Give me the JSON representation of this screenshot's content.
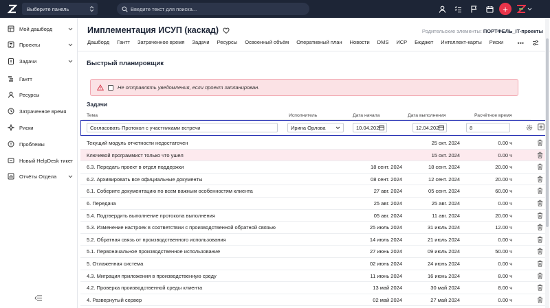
{
  "topbar": {
    "panel_select": "Выберите панель",
    "search_placeholder": "Введите текст для поиска...",
    "plus_label": "+"
  },
  "sidebar": {
    "items": [
      {
        "label": "Мой дашборд",
        "icon": "dashboard-icon",
        "expandable": true
      },
      {
        "label": "Проекты",
        "icon": "projects-icon",
        "expandable": true
      },
      {
        "label": "Задачи",
        "icon": "tasks-icon",
        "expandable": true
      },
      {
        "label": "Гантт",
        "icon": "gantt-icon",
        "expandable": false
      },
      {
        "label": "Ресурсы",
        "icon": "user-icon",
        "expandable": false
      },
      {
        "label": "Затраченное время",
        "icon": "clock-icon",
        "expandable": false
      },
      {
        "label": "Риски",
        "icon": "risk-icon",
        "expandable": false
      },
      {
        "label": "Проблемы",
        "icon": "issue-icon",
        "expandable": false
      },
      {
        "label": "Новый HelpDesk тикет",
        "icon": "ticket-icon",
        "expandable": false
      },
      {
        "label": "Отчёты Отдела",
        "icon": "reports-icon",
        "expandable": true
      }
    ]
  },
  "page": {
    "title": "Имплементация ИСУП (каскад)",
    "parents_label": "Родительские элементы:",
    "parents_value": "ПОРТФЕЛЬ_IT-проекты",
    "more_label": "•••"
  },
  "tabs": [
    "Дашборд",
    "Гантт",
    "Затраченное время",
    "Задачи",
    "Ресурсы",
    "Освоенный объём",
    "Оперативный план",
    "Новости",
    "DMS",
    "ИСР",
    "Бюджет",
    "Интеллект-карты",
    "Риски"
  ],
  "planner": {
    "title": "Быстрый планировщик",
    "alert_text": "Не отправлять уведомления, если проект запланирован.",
    "tasks_title": "Задачи"
  },
  "columns": {
    "subject": "Тема",
    "assignee": "Исполнитель",
    "start": "Дата начала",
    "due": "Дата выполнения",
    "estimate": "Расчётное время"
  },
  "edit_row": {
    "subject": "Согласовать Протокол с участниками встречи",
    "assignee": "Ирина Орлова",
    "start": "10.04.202",
    "due": "12.04.202",
    "estimate": "8"
  },
  "rows": [
    {
      "subject": "Текущий модуль отчетности недостаточен",
      "start": "",
      "due": "25 окт. 2024",
      "estimate": "0.00 ч",
      "highlight": false
    },
    {
      "subject": "Ключевой программист только что ушел",
      "start": "",
      "due": "15 окт. 2024",
      "estimate": "0.00 ч",
      "highlight": true
    },
    {
      "subject": "6.3. Передать проект в отдел поддержки",
      "start": "18 сент. 2024",
      "due": "18 сент. 2024",
      "estimate": "20.00 ч",
      "highlight": false
    },
    {
      "subject": "6.2. Архивировать все официальные документы",
      "start": "08 сент. 2024",
      "due": "12 сент. 2024",
      "estimate": "20.00 ч",
      "highlight": false
    },
    {
      "subject": "6.1. Соберите документацию по всем важным особенностям клиента",
      "start": "27 авг. 2024",
      "due": "05 сент. 2024",
      "estimate": "60.00 ч",
      "highlight": false
    },
    {
      "subject": "6. Передача",
      "start": "25 авг. 2024",
      "due": "25 авг. 2024",
      "estimate": "0.00 ч",
      "highlight": false
    },
    {
      "subject": "5.4. Подтвердить выполнение протокола выполнения",
      "start": "05 авг. 2024",
      "due": "11 авг. 2024",
      "estimate": "20.00 ч",
      "highlight": false
    },
    {
      "subject": "5.3. Изменение настроек в соответствии с производственной обратной связью",
      "start": "25 июль 2024",
      "due": "31 июль 2024",
      "estimate": "12.00 ч",
      "highlight": false
    },
    {
      "subject": "5.2. Обратная связь от производственного использования",
      "start": "14 июль 2024",
      "due": "21 июль 2024",
      "estimate": "0.00 ч",
      "highlight": false
    },
    {
      "subject": "5.1. Первоначальное производственное использование",
      "start": "27 июнь 2024",
      "due": "09 июль 2024",
      "estimate": "50.00 ч",
      "highlight": false
    },
    {
      "subject": "5. Отлаженная система",
      "start": "02 июнь 2024",
      "due": "24 июнь 2024",
      "estimate": "0.00 ч",
      "highlight": false
    },
    {
      "subject": "4.3. Миграция приложения в производственную среду",
      "start": "11 июнь 2024",
      "due": "16 июнь 2024",
      "estimate": "8.00 ч",
      "highlight": false
    },
    {
      "subject": "4.2. Проверка производственной среды клиента",
      "start": "13 май 2024",
      "due": "30 май 2024",
      "estimate": "8.00 ч",
      "highlight": false
    },
    {
      "subject": "4. Развернутый сервер",
      "start": "02 май 2024",
      "due": "27 май 2024",
      "estimate": "0.00 ч",
      "highlight": false
    }
  ]
}
